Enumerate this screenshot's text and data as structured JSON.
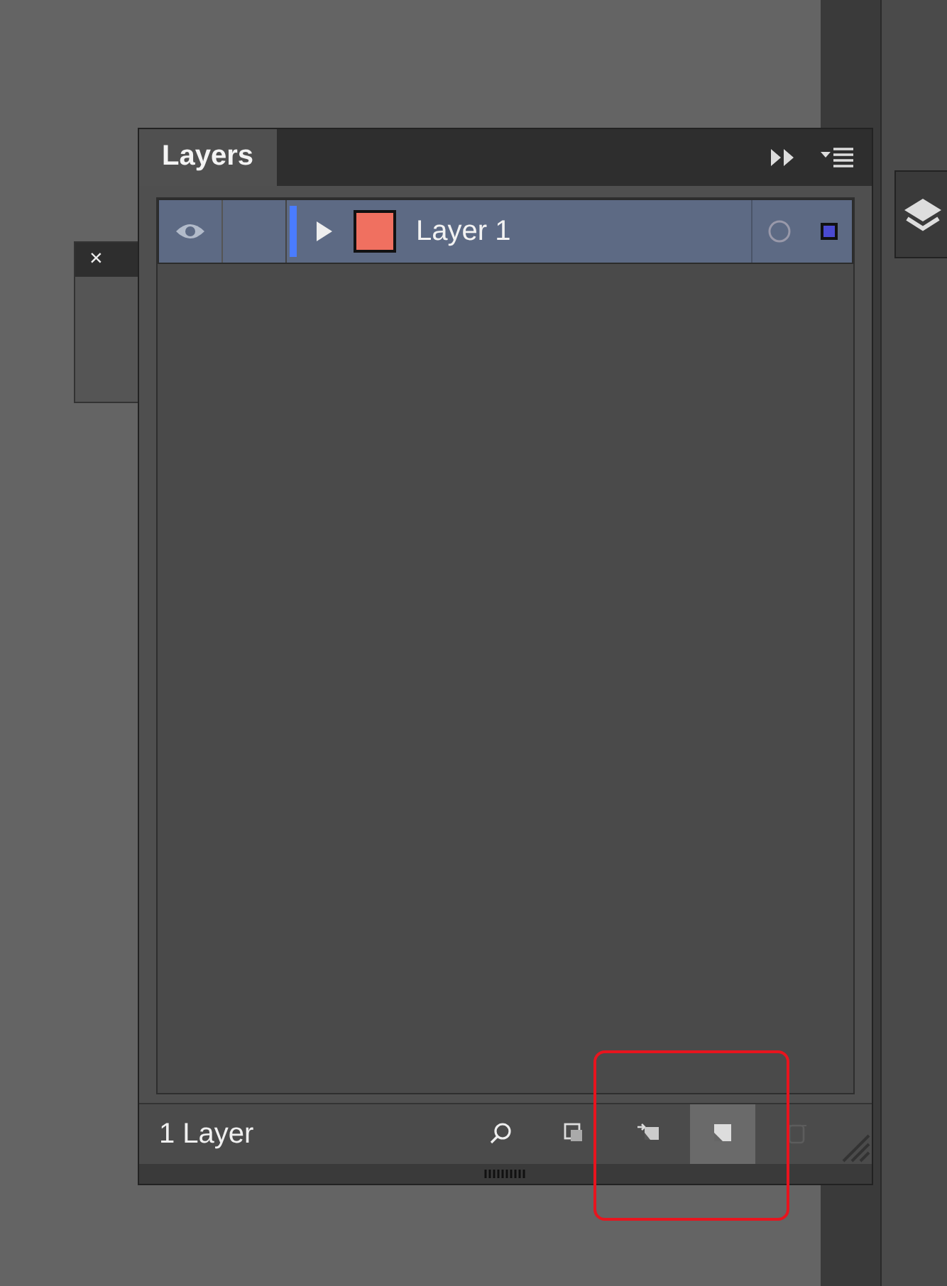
{
  "side_panel": {
    "close_label": "×"
  },
  "layers_panel": {
    "title": "Layers",
    "layers": [
      {
        "name": "Layer 1",
        "visible": true,
        "selected": true,
        "expanded": false,
        "color": "#4a7cff"
      }
    ],
    "status": "1 Layer",
    "footer_buttons": [
      {
        "kind": "search",
        "pressed": false,
        "disabled": false
      },
      {
        "kind": "clip",
        "pressed": false,
        "disabled": false
      },
      {
        "kind": "sublayer",
        "pressed": false,
        "disabled": false
      },
      {
        "kind": "newlayer",
        "pressed": true,
        "disabled": false
      },
      {
        "kind": "trash",
        "pressed": false,
        "disabled": true
      }
    ]
  },
  "highlight": {
    "shown": true
  }
}
